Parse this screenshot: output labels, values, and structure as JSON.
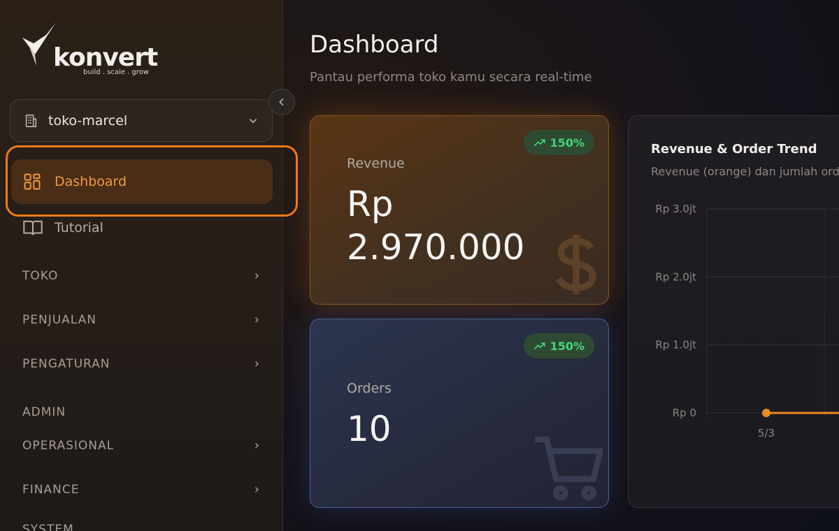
{
  "brand": {
    "name": "konvert",
    "tagline": "build . scale . grow"
  },
  "store": {
    "name": "toko-marcel"
  },
  "nav": {
    "active": {
      "label": "Dashboard"
    },
    "tutorial": {
      "label": "Tutorial"
    },
    "sections": [
      {
        "label": "TOKO"
      },
      {
        "label": "PENJUALAN"
      },
      {
        "label": "PENGATURAN"
      },
      {
        "label": "ADMIN"
      },
      {
        "label": "OPERASIONAL"
      },
      {
        "label": "FINANCE"
      },
      {
        "label": "SYSTEM"
      }
    ]
  },
  "header": {
    "title": "Dashboard",
    "subtitle": "Pantau performa toko kamu secara real-time"
  },
  "cards": {
    "revenue": {
      "label": "Revenue",
      "value_line1": "Rp",
      "value_line2": "2.970.000",
      "badge": "150%"
    },
    "orders": {
      "label": "Orders",
      "value": "10",
      "badge": "150%"
    }
  },
  "chart": {
    "title": "Revenue & Order Trend",
    "subtitle": "Revenue (orange) dan jumlah order"
  },
  "chart_data": {
    "type": "line",
    "title": "Revenue & Order Trend",
    "y_ticks": [
      "Rp 3.0jt",
      "Rp 2.0jt",
      "Rp 1.0jt",
      "Rp 0"
    ],
    "x_ticks": [
      "5/3"
    ],
    "ylim": [
      0,
      3000000
    ],
    "series": [
      {
        "name": "Revenue",
        "color": "#f08a1c",
        "points": [
          {
            "x": "5/3",
            "y": 0
          }
        ]
      }
    ],
    "grid": true
  },
  "colors": {
    "accent": "#f08a1c",
    "success": "#43d679"
  }
}
